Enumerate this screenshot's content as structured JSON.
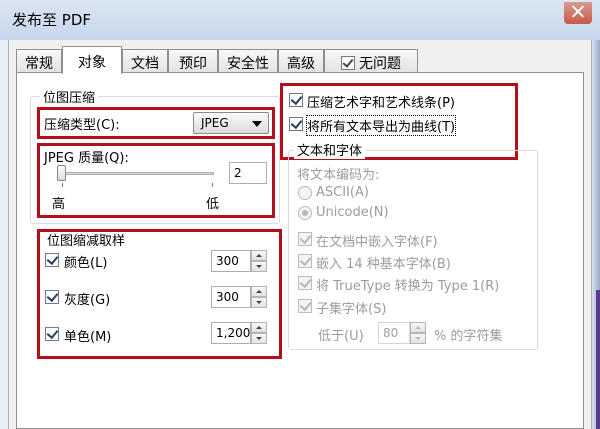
{
  "window": {
    "title": "发布至 PDF"
  },
  "tabs": [
    {
      "label": "常规"
    },
    {
      "label": "对象"
    },
    {
      "label": "文档"
    },
    {
      "label": "预印"
    },
    {
      "label": "安全性"
    },
    {
      "label": "高级"
    },
    {
      "label": "无问题",
      "icon": "check-icon"
    }
  ],
  "active_tab": "对象",
  "bitmap_compression": {
    "title": "位图压缩",
    "type_label": "压缩类型(C):",
    "type_value": "JPEG",
    "quality_label": "JPEG 质量(Q):",
    "quality_value": "2",
    "quality_high_label": "高",
    "quality_low_label": "低"
  },
  "downsampling": {
    "title": "位图缩减取样",
    "rows": [
      {
        "label": "颜色(L)",
        "checked": true,
        "value": "300"
      },
      {
        "label": "灰度(G)",
        "checked": true,
        "value": "300"
      },
      {
        "label": "单色(M)",
        "checked": true,
        "value": "1,200"
      }
    ]
  },
  "options": [
    {
      "label": "压缩艺术字和艺术线条(P)",
      "checked": true
    },
    {
      "label": "将所有文本导出为曲线(T)",
      "checked": true
    }
  ],
  "text_fonts": {
    "title": "文本和字体",
    "encoding_label": "将文本编码为:",
    "encodings": [
      {
        "label": "ASCII(A)",
        "selected": false
      },
      {
        "label": "Unicode(N)",
        "selected": true
      }
    ],
    "font_options": [
      {
        "label": "在文档中嵌入字体(F)",
        "checked": true
      },
      {
        "label": "嵌入 14 种基本字体(B)",
        "checked": true
      },
      {
        "label": "将 TrueType 转换为 Type 1(R)",
        "checked": true
      },
      {
        "label": "子集字体(S)",
        "checked": true
      }
    ],
    "subset_prefix": "低于(U)",
    "subset_value": "80",
    "subset_suffix": "% 的字符集"
  },
  "colors": {
    "highlight_box": "#b4101c",
    "close_button": "#c75a46",
    "disabled_text": "#9c9c9c"
  }
}
